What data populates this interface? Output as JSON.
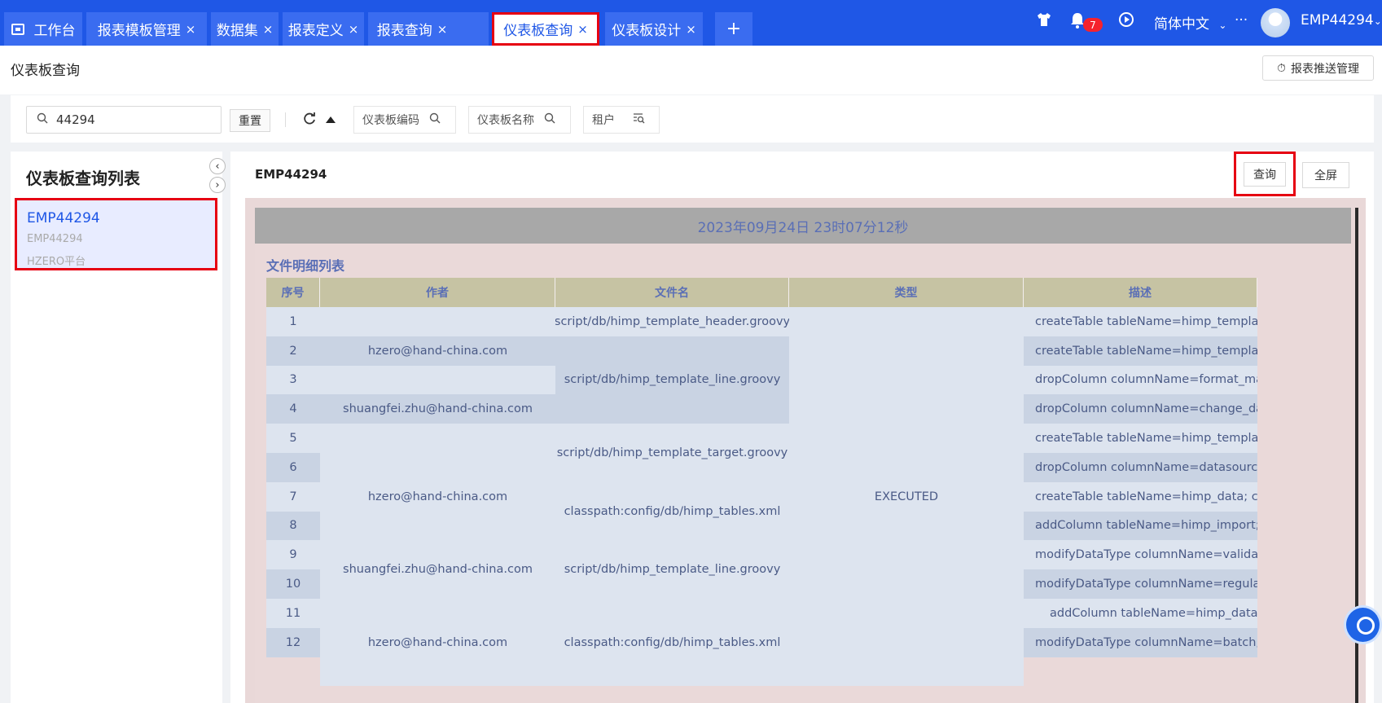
{
  "tabs": [
    {
      "label": "工作台",
      "closable": false
    },
    {
      "label": "报表模板管理",
      "closable": true
    },
    {
      "label": "数据集",
      "closable": true
    },
    {
      "label": "报表定义",
      "closable": true
    },
    {
      "label": "报表查询",
      "closable": true
    },
    {
      "label": "仪表板查询",
      "closable": true,
      "active": true
    },
    {
      "label": "仪表板设计",
      "closable": true
    }
  ],
  "topbar": {
    "add_tab": "+",
    "close_glyph": "×",
    "notification_count": "7",
    "language": "简体中文",
    "more": "···",
    "user": "EMP44294"
  },
  "page": {
    "title": "仪表板查询",
    "push_button": "报表推送管理"
  },
  "search": {
    "value": "44294",
    "reset_label": "重置",
    "filters": [
      {
        "label": "仪表板编码"
      },
      {
        "label": "仪表板名称"
      },
      {
        "label": "租户"
      }
    ]
  },
  "left": {
    "title": "仪表板查询列表",
    "item": {
      "name": "EMP44294",
      "code": "EMP44294",
      "tenant": "HZERO平台"
    }
  },
  "right": {
    "dashboard_name": "EMP44294",
    "query_label": "查询",
    "fullscreen_label": "全屏"
  },
  "report": {
    "datetime": "2023年09月24日  23时07分12秒",
    "section_title": "文件明细列表",
    "headers": [
      "序号",
      "作者",
      "文件名",
      "类型",
      "描述"
    ],
    "rows": [
      "1",
      "2",
      "3",
      "4",
      "5",
      "6",
      "7",
      "8",
      "9",
      "10",
      "11",
      "12"
    ],
    "authors": [
      {
        "text": "hzero@hand-china.com"
      },
      {
        "text": "shuangfei.zhu@hand-china.com"
      },
      {
        "text": "hzero@hand-china.com"
      },
      {
        "text": "shuangfei.zhu@hand-china.com"
      },
      {
        "text": "hzero@hand-china.com"
      }
    ],
    "files": [
      {
        "text": "script/db/himp_template_header.groovy"
      },
      {
        "text": "script/db/himp_template_line.groovy"
      },
      {
        "text": "script/db/himp_template_target.groovy"
      },
      {
        "text": "classpath:config/db/himp_tables.xml"
      },
      {
        "text": "script/db/himp_template_line.groovy"
      },
      {
        "text": "classpath:config/db/himp_tables.xml"
      }
    ],
    "type_value": "EXECUTED",
    "descriptions": [
      "createTable tableName=himp_template_header",
      "createTable tableName=himp_template_line",
      "dropColumn columnName=format_mask, t",
      "dropColumn columnName=change_data_u",
      "createTable tableName=himp_template_target",
      "dropColumn columnName=datasource_id,",
      "createTable tableName=himp_data; createT",
      "addColumn tableName=himp_import; add",
      "modifyDataType columnName=validate_se",
      "modifyDataType columnName=regular_exp",
      "addColumn tableName=himp_data",
      "modifyDataType columnName=batch, table"
    ]
  }
}
